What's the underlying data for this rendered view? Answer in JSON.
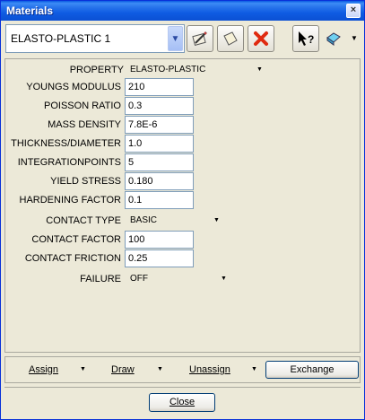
{
  "window": {
    "title": "Materials",
    "close_glyph": "×"
  },
  "toolbar": {
    "material_selected": "ELASTO-PLASTIC 1",
    "icons": [
      "edit-icon",
      "copy-icon",
      "delete-icon",
      "help-icon",
      "color-swatch-icon"
    ]
  },
  "properties": {
    "property": {
      "label": "PROPERTY",
      "value": "ELASTO-PLASTIC"
    },
    "youngs_modulus": {
      "label": "YOUNGS MODULUS",
      "value": "210"
    },
    "poisson_ratio": {
      "label": "POISSON RATIO",
      "value": "0.3"
    },
    "mass_density": {
      "label": "MASS DENSITY",
      "value": "7.8E-6"
    },
    "thickness": {
      "label": "THICKNESS/DIAMETER",
      "value": "1.0"
    },
    "integration_points": {
      "label": "INTEGRATIONPOINTS",
      "value": "5"
    },
    "yield_stress": {
      "label": "YIELD STRESS",
      "value": "0.180"
    },
    "hardening_factor": {
      "label": "HARDENING FACTOR",
      "value": "0.1"
    },
    "contact_type": {
      "label": "CONTACT TYPE",
      "value": "BASIC"
    },
    "contact_factor": {
      "label": "CONTACT FACTOR",
      "value": "100"
    },
    "contact_friction": {
      "label": "CONTACT FRICTION",
      "value": "0.25"
    },
    "failure": {
      "label": "FAILURE",
      "value": "OFF"
    }
  },
  "actions": {
    "assign": "Assign",
    "draw": "Draw",
    "unassign": "Unassign",
    "exchange": "Exchange"
  },
  "footer": {
    "close": "Close"
  },
  "colors": {
    "title_bar": "#0b50d3",
    "delete_red": "#e02a10",
    "face": "#ece9d8"
  }
}
